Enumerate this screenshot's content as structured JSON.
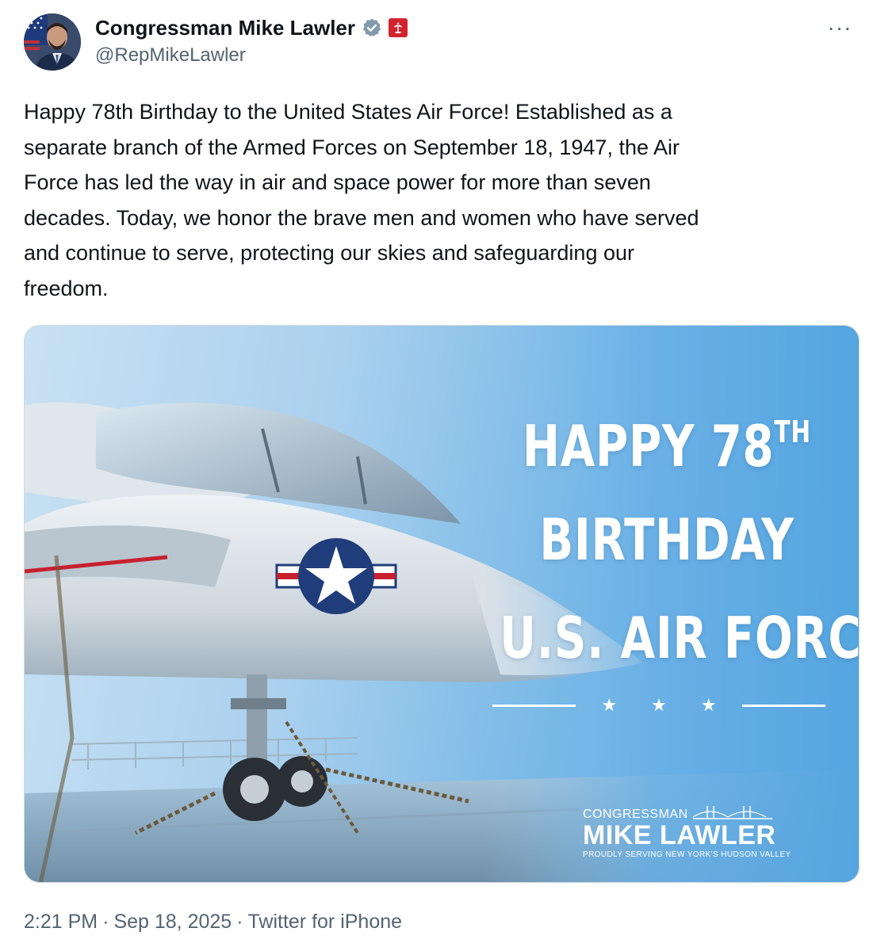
{
  "author": {
    "display_name": "Congressman Mike Lawler",
    "handle": "@RepMikeLawler"
  },
  "tweet": {
    "text": "Happy 78th Birthday to the United States Air Force! Established as a\nseparate branch of the Armed Forces on September 18, 1947, the Air\nForce has led the way in air and space power for more than seven\ndecades. Today, we honor the brave men and women who have served\nand continue to serve, protecting our skies and safeguarding our\nfreedom."
  },
  "media": {
    "headline": {
      "line1_main": "HAPPY 78",
      "line1_sup": "TH",
      "line2": "BIRTHDAY",
      "line3": "U.S. AIR FORCE"
    },
    "stars": "★ ★ ★",
    "brand": {
      "top": "CONGRESSMAN",
      "name": "MIKE LAWLER",
      "tagline": "PROUDLY SERVING NEW YORK'S HUDSON VALLEY"
    }
  },
  "meta": {
    "time": "2:21 PM",
    "date": "Sep 18, 2025",
    "source": "Twitter for iPhone",
    "separator": "·"
  },
  "more_icon_glyph": "···",
  "colors": {
    "text": "#0f1419",
    "secondary": "#536471",
    "verified_badge": "#829aab",
    "gov_badge": "#d1242f"
  }
}
